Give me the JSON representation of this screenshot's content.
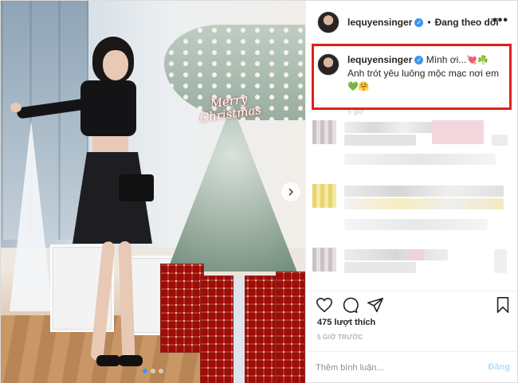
{
  "header": {
    "username": "lequyensinger",
    "separator": "•",
    "follow_label": "Đang theo dõi",
    "more_icon": "more-icon",
    "verified_icon": "verified-badge-icon"
  },
  "caption": {
    "username": "lequyensinger",
    "text": "Mình ơi...",
    "emoji1": "💘",
    "emoji2": "☘️",
    "line2": "Anh trót yêu luông mộc mạc nơi em",
    "emoji3": "💚",
    "emoji4": "🤗",
    "time": "5 giờ"
  },
  "photo": {
    "sign_text": "Merry Christmas",
    "next_icon": "chevron-right-icon",
    "slide_dots": 3,
    "active_dot": 0
  },
  "actions": {
    "like_icon": "heart-icon",
    "comment_icon": "comment-icon",
    "share_icon": "share-icon",
    "save_icon": "bookmark-icon",
    "likes_label": "475 lượt thích",
    "time_label": "5 GIỜ TRƯỚC"
  },
  "comment": {
    "placeholder": "Thêm bình luận...",
    "post_label": "Đăng"
  },
  "colors": {
    "highlight": "#e0201b",
    "verified": "#3897f0",
    "post_button": "#b2dffc"
  }
}
